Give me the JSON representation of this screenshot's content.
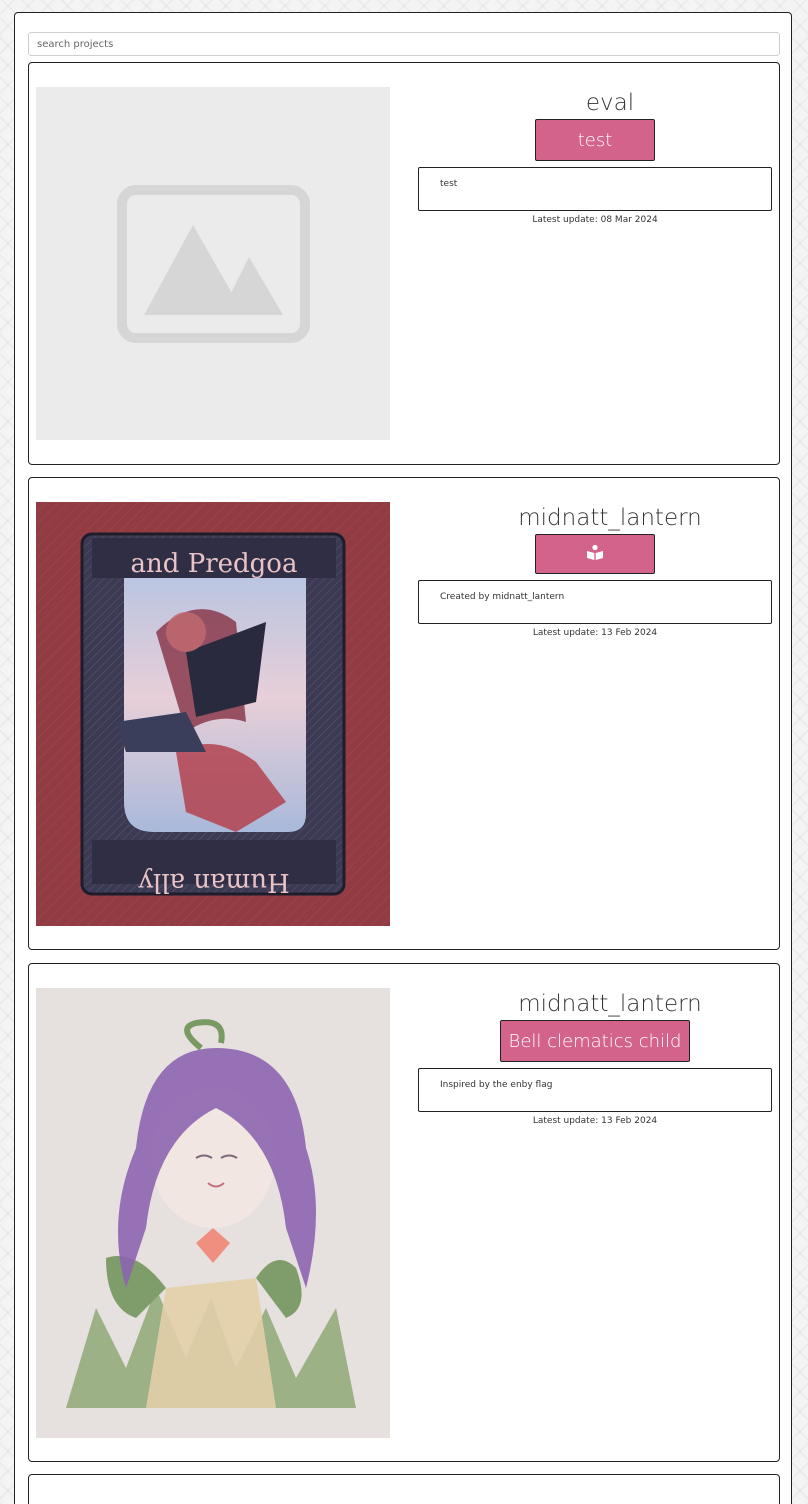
{
  "search": {
    "placeholder": "search projects"
  },
  "projects": [
    {
      "owner": "eval",
      "title": "test",
      "description": "test",
      "latest_update_label": "Latest update:",
      "latest_update_date": "08 Mar 2024",
      "image": "placeholder-image-icon"
    },
    {
      "owner": "midnatt_lantern",
      "title": "",
      "title_icon": "book-icon",
      "description": "Created by midnatt_lantern",
      "latest_update_label": "Latest update:",
      "latest_update_date": "13 Feb 2024",
      "image": "tarot-card-artwork",
      "image_text_top": "and Predgoa",
      "image_text_bottom": "Human ally"
    },
    {
      "owner": "midnatt_lantern",
      "title": "Bell clematics child",
      "description": "Inspired by the enby flag",
      "latest_update_label": "Latest update:",
      "latest_update_date": "13 Feb 2024",
      "image": "character-artwork"
    }
  ],
  "colors": {
    "accent": "#d3638a",
    "border": "#222222"
  }
}
